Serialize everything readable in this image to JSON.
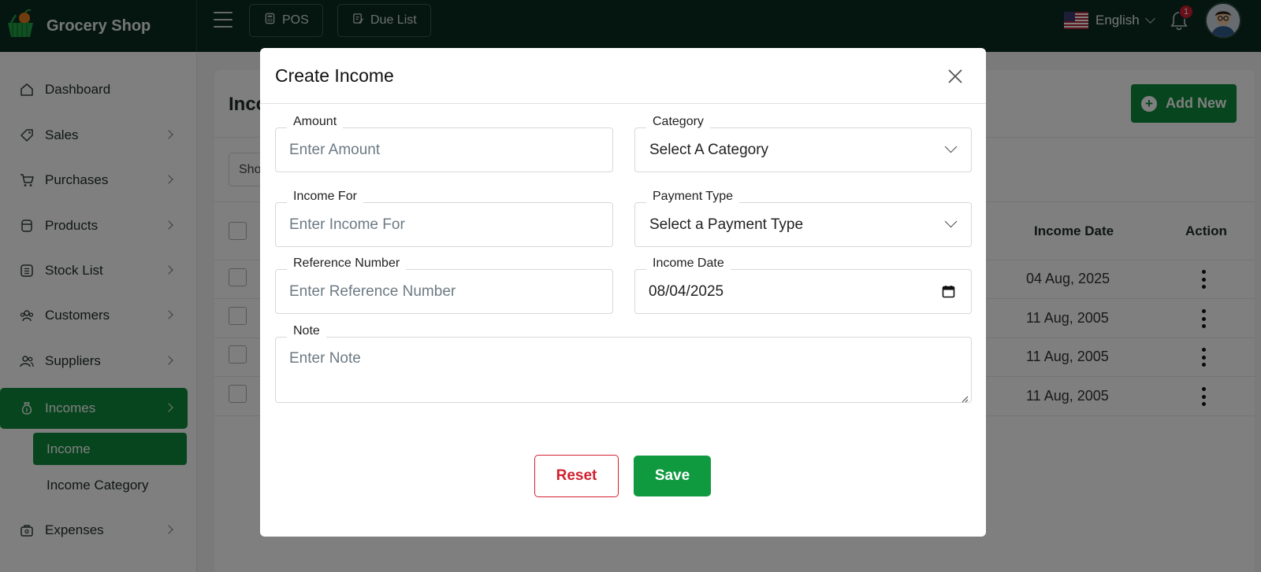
{
  "app": {
    "brand": "Grocery Shop"
  },
  "topbar": {
    "pos_label": "POS",
    "due_list_label": "Due List",
    "language": "English",
    "notification_count": "1"
  },
  "sidebar": {
    "items": [
      {
        "label": "Dashboard",
        "icon": "dashboard-icon"
      },
      {
        "label": "Sales",
        "icon": "tag-icon"
      },
      {
        "label": "Purchases",
        "icon": "cart-icon"
      },
      {
        "label": "Products",
        "icon": "box-icon"
      },
      {
        "label": "Stock List",
        "icon": "list-icon"
      },
      {
        "label": "Customers",
        "icon": "users-icon"
      },
      {
        "label": "Suppliers",
        "icon": "user-group-icon"
      },
      {
        "label": "Incomes",
        "icon": "money-bag-icon"
      },
      {
        "label": "Expenses",
        "icon": "briefcase-icon"
      }
    ],
    "sub_items": [
      {
        "label": "Income"
      },
      {
        "label": "Income Category"
      }
    ]
  },
  "page": {
    "title_partial": "Inco",
    "add_new_label": "Add New",
    "show_partial": "Sho",
    "columns": {
      "income_date": "Income Date",
      "action": "Action"
    },
    "rows": [
      {
        "income_date": "04 Aug, 2025"
      },
      {
        "income_date": "11 Aug, 2005"
      },
      {
        "income_date": "11 Aug, 2005"
      },
      {
        "income_date": "11 Aug, 2005"
      }
    ]
  },
  "modal": {
    "title": "Create Income",
    "fields": {
      "amount": {
        "label": "Amount",
        "placeholder": "Enter Amount"
      },
      "category": {
        "label": "Category",
        "value": "Select A Category"
      },
      "income_for": {
        "label": "Income For",
        "placeholder": "Enter Income For"
      },
      "payment_type": {
        "label": "Payment Type",
        "value": "Select a Payment Type"
      },
      "reference_number": {
        "label": "Reference Number",
        "placeholder": "Enter Reference Number"
      },
      "income_date": {
        "label": "Income Date",
        "value": "08/04/2025"
      },
      "note": {
        "label": "Note",
        "placeholder": "Enter Note"
      }
    },
    "reset_label": "Reset",
    "save_label": "Save"
  },
  "colors": {
    "topbar": "#0a2c22",
    "primary_green": "#0f8a3c",
    "danger_red": "#d11f2e"
  }
}
